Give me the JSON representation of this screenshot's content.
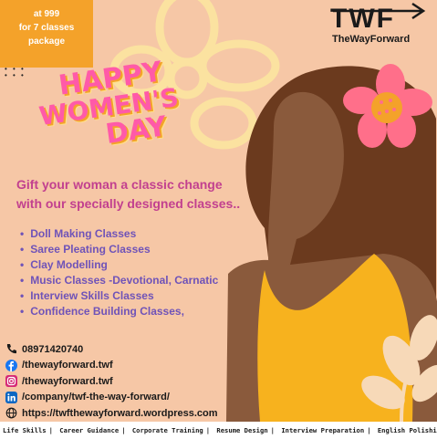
{
  "badge": {
    "line1": "at 999",
    "line2": "for 7 classes",
    "line3": "package"
  },
  "dots": "• • •\n• • •",
  "logo": {
    "mark": "TWF",
    "name": "TheWayForward"
  },
  "headline": {
    "line1": "HAPPY",
    "line2": "WOMEN'S",
    "line3": "DAY"
  },
  "tagline": {
    "line1": "Gift your woman a classic change",
    "line2": "with our specially designed  classes.."
  },
  "classes": [
    "Doll Making Classes",
    "Saree Pleating Classes",
    "Clay Modelling",
    "Music Classes -Devotional, Carnatic",
    "Interview Skills Classes",
    "Confidence Building Classes,"
  ],
  "contacts": {
    "phone": "08971420740",
    "facebook": "/thewayforward.twf",
    "instagram": "/thewayforward.twf",
    "linkedin": "/company/twf-the-way-forward/",
    "website": "https://twfthewayforward.wordpress.com"
  },
  "footer": [
    "Life Skills",
    "Career Guidance",
    "Corporate Training",
    "Resume Design",
    "Interview Preparation",
    "English Polishing"
  ],
  "colors": {
    "background": "#f6c7a6",
    "badge": "#f4a22a",
    "headline": "#ff5aa8",
    "tagline": "#c2408f",
    "list": "#6f53b8",
    "skin": "#8a5a3c",
    "hair": "#6b3a1e",
    "dress": "#f7b21e",
    "flower_pink": "#ff6f8a",
    "leaf": "#f7d9b8"
  }
}
